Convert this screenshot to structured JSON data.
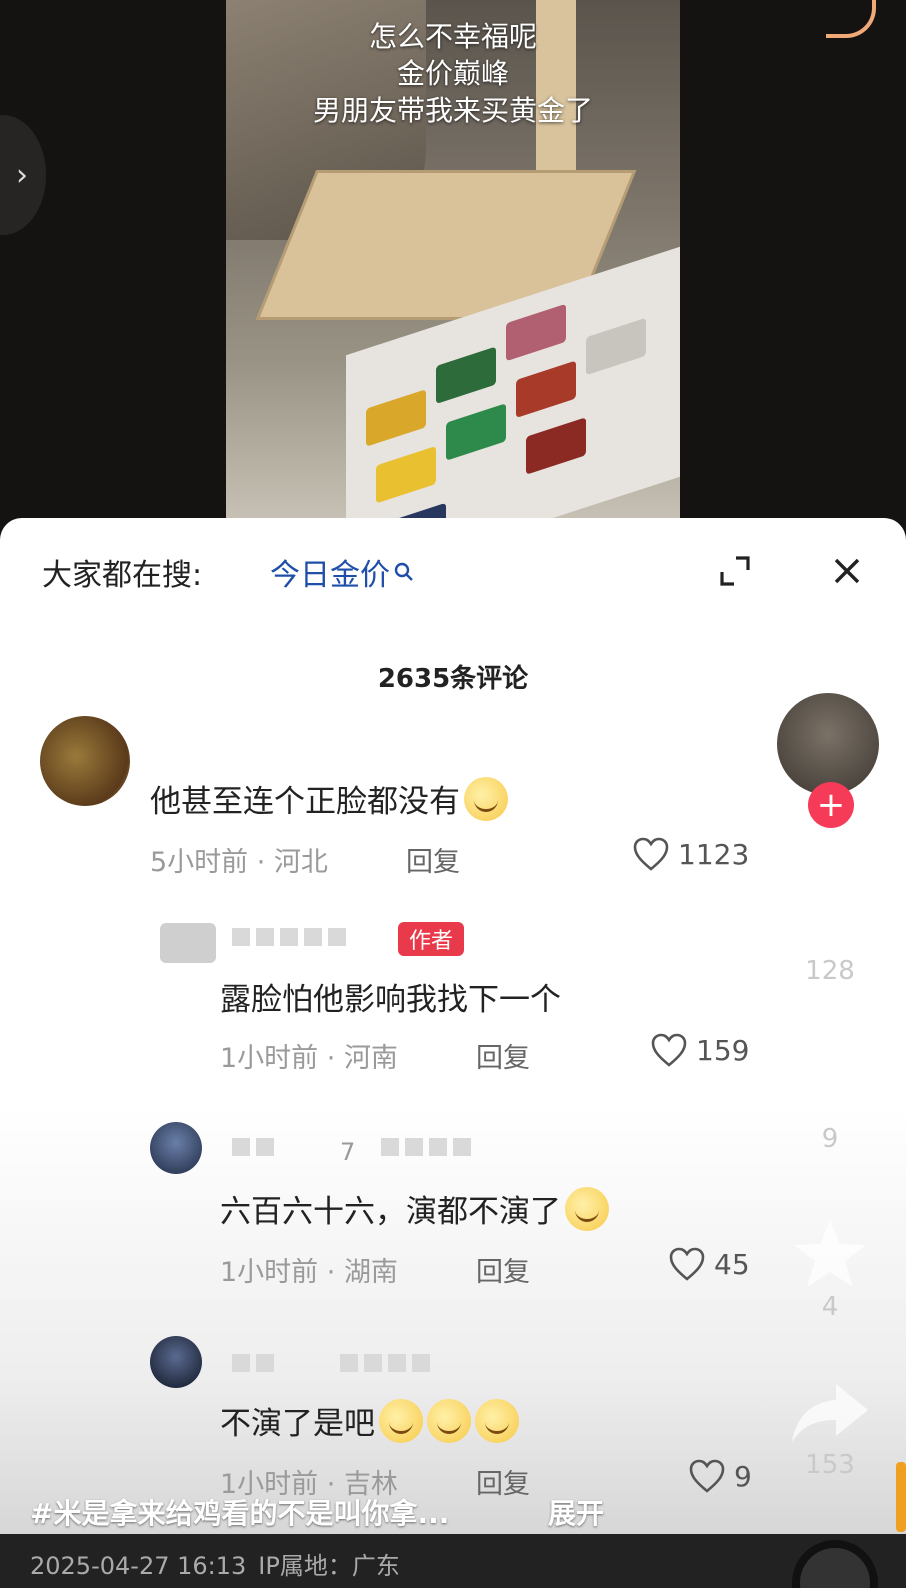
{
  "video": {
    "caption_lines": [
      "怎么不幸福呢",
      "金价巅峰",
      "男朋友带我来买黄金了"
    ]
  },
  "panel": {
    "search_hint": "大家都在搜:",
    "search_term": "今日金价",
    "comment_count_title": "2635条评论"
  },
  "comments": [
    {
      "text": "他甚至连个正脸都没有",
      "time": "5小时前",
      "location": "河北",
      "reply_label": "回复",
      "likes": "1123"
    },
    {
      "badge": "作者",
      "text": "露脸怕他影响我找下一个",
      "time": "1小时前",
      "location": "河南",
      "reply_label": "回复",
      "likes": "159"
    },
    {
      "text": "六百六十六，演都不演了",
      "nick_partial": "7",
      "time": "1小时前",
      "location": "湖南",
      "reply_label": "回复",
      "likes": "45"
    },
    {
      "text": "不演了是吧",
      "time": "1小时前",
      "location": "吉林",
      "reply_label": "回复",
      "likes": "9"
    }
  ],
  "side_actions": {
    "like_count": "128",
    "comment_count": "9",
    "favorite_count": "4",
    "share_count": "153"
  },
  "bottom": {
    "hashtag": "#米是拿来给鸡看的不是叫你拿...",
    "expand_label": "展开",
    "date": "2025-04-27 16:13",
    "ip_label": "IP属地：广东"
  },
  "colors": {
    "author_badge": "#e93a4c",
    "follow_button": "#f53b57",
    "search_term": "#1f4fa8"
  }
}
